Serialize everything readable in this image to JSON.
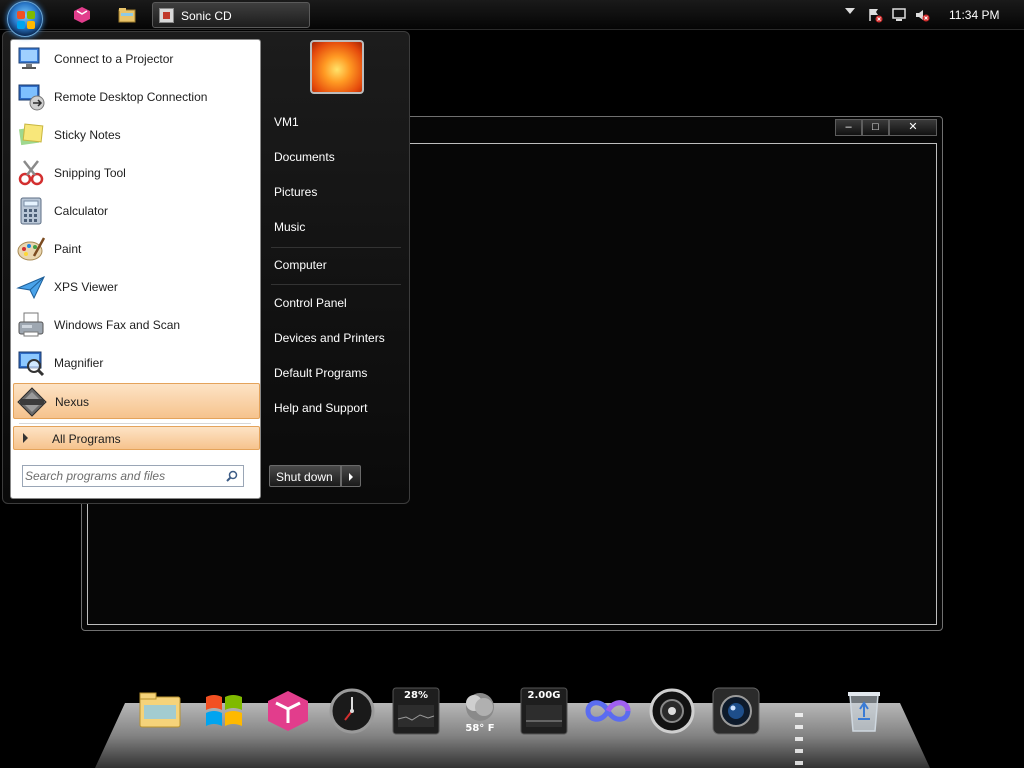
{
  "taskbar": {
    "task_button_label": "Sonic CD",
    "clock": "11:34 PM"
  },
  "window": {
    "minimize_label": "–",
    "maximize_label": "□",
    "close_label": "✕"
  },
  "start_menu": {
    "programs": [
      {
        "label": "Connect to a Projector",
        "icon": "projector-icon"
      },
      {
        "label": "Remote Desktop Connection",
        "icon": "remote-desktop-icon"
      },
      {
        "label": "Sticky Notes",
        "icon": "sticky-notes-icon"
      },
      {
        "label": "Snipping Tool",
        "icon": "scissors-icon"
      },
      {
        "label": "Calculator",
        "icon": "calculator-icon"
      },
      {
        "label": "Paint",
        "icon": "palette-icon"
      },
      {
        "label": "XPS Viewer",
        "icon": "paper-plane-icon"
      },
      {
        "label": "Windows Fax and Scan",
        "icon": "fax-icon"
      },
      {
        "label": "Magnifier",
        "icon": "magnifier-icon"
      },
      {
        "label": "Nexus",
        "icon": "nexus-icon"
      }
    ],
    "all_programs": "All Programs",
    "search_placeholder": "Search programs and files",
    "right_links": [
      "VM1",
      "Documents",
      "Pictures",
      "Music",
      "Computer",
      "Control Panel",
      "Devices and Printers",
      "Default Programs",
      "Help and Support"
    ],
    "shutdown_label": "Shut down"
  },
  "dock": {
    "items": [
      "folder-icon",
      "windows-logo-icon",
      "cube-icon",
      "clock-icon",
      "cpu-meter-icon",
      "weather-icon",
      "memory-meter-icon",
      "infinity-icon",
      "headphones-icon",
      "camera-icon",
      "recycle-bin-icon"
    ],
    "cpu_readout": "28%",
    "memory_readout": "2.00G",
    "weather_readout": "58° F"
  }
}
